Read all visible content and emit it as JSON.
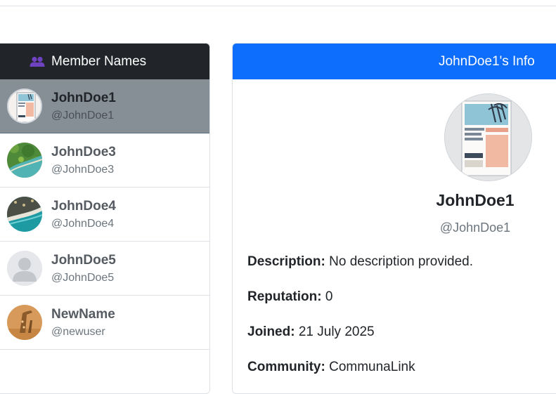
{
  "members": {
    "header_label": "Member Names",
    "header_icon": "people-icon",
    "items": [
      {
        "display": "JohnDoe1",
        "handle": "@JohnDoe1",
        "avatar": "poster-avatar",
        "active": true
      },
      {
        "display": "JohnDoe3",
        "handle": "@JohnDoe3",
        "avatar": "aerial-coast-avatar",
        "active": false
      },
      {
        "display": "JohnDoe4",
        "handle": "@JohnDoe4",
        "avatar": "aerial-beach-avatar",
        "active": false
      },
      {
        "display": "JohnDoe5",
        "handle": "@JohnDoe5",
        "avatar": "default-user-avatar",
        "active": false
      },
      {
        "display": "NewName",
        "handle": "@newuser",
        "avatar": "giraffe-avatar",
        "active": false
      }
    ]
  },
  "info": {
    "header_label": "JohnDoe1's Info",
    "name": "JohnDoe1",
    "handle": "@JohnDoe1",
    "description_label": "Description:",
    "description_value": "No description provided.",
    "reputation_label": "Reputation:",
    "reputation_value": "0",
    "joined_label": "Joined:",
    "joined_value": "21 July 2025",
    "community_label": "Community:",
    "community_value": "CommunaLink"
  },
  "colors": {
    "dark_header": "#212529",
    "primary": "#0d6efd",
    "active_row": "#868e96",
    "icon_purple": "#6f42c1"
  }
}
